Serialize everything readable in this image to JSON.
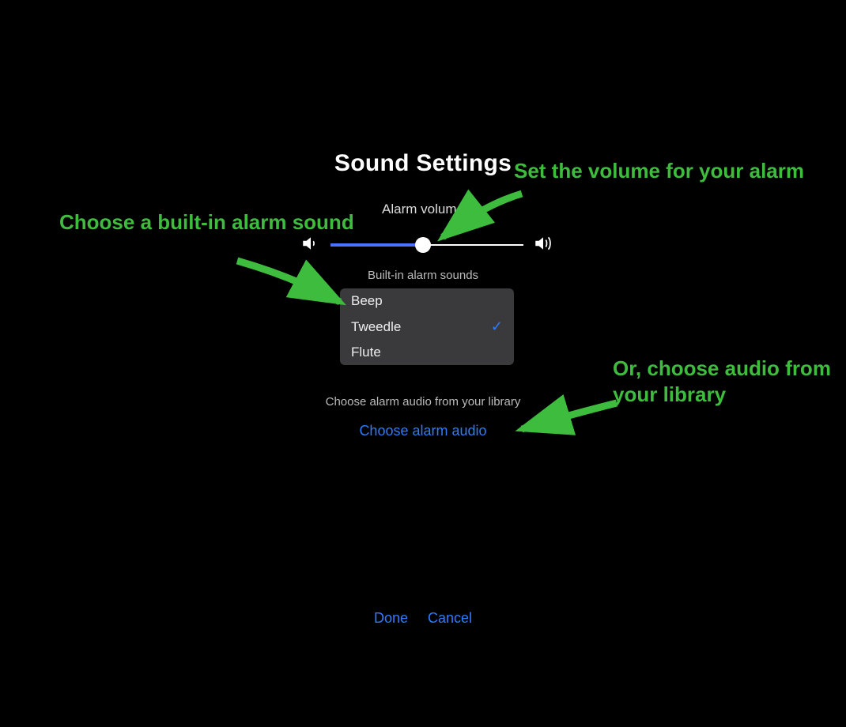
{
  "title": "Sound Settings",
  "volume": {
    "label": "Alarm volume",
    "percent": 48,
    "low_icon": "speaker-low-icon",
    "high_icon": "speaker-high-icon"
  },
  "builtin": {
    "label": "Built-in alarm sounds",
    "items": [
      {
        "name": "Beep",
        "selected": false
      },
      {
        "name": "Tweedle",
        "selected": true
      },
      {
        "name": "Flute",
        "selected": false
      }
    ]
  },
  "library": {
    "label": "Choose alarm audio from your library",
    "link": "Choose alarm audio"
  },
  "buttons": {
    "done": "Done",
    "cancel": "Cancel"
  },
  "annotations": {
    "volume": "Set the volume for your alarm",
    "builtin": "Choose a built-in alarm sound",
    "library": "Or, choose audio from your library"
  },
  "colors": {
    "accent": "#2f7bff",
    "annotation": "#3ebc3e"
  }
}
